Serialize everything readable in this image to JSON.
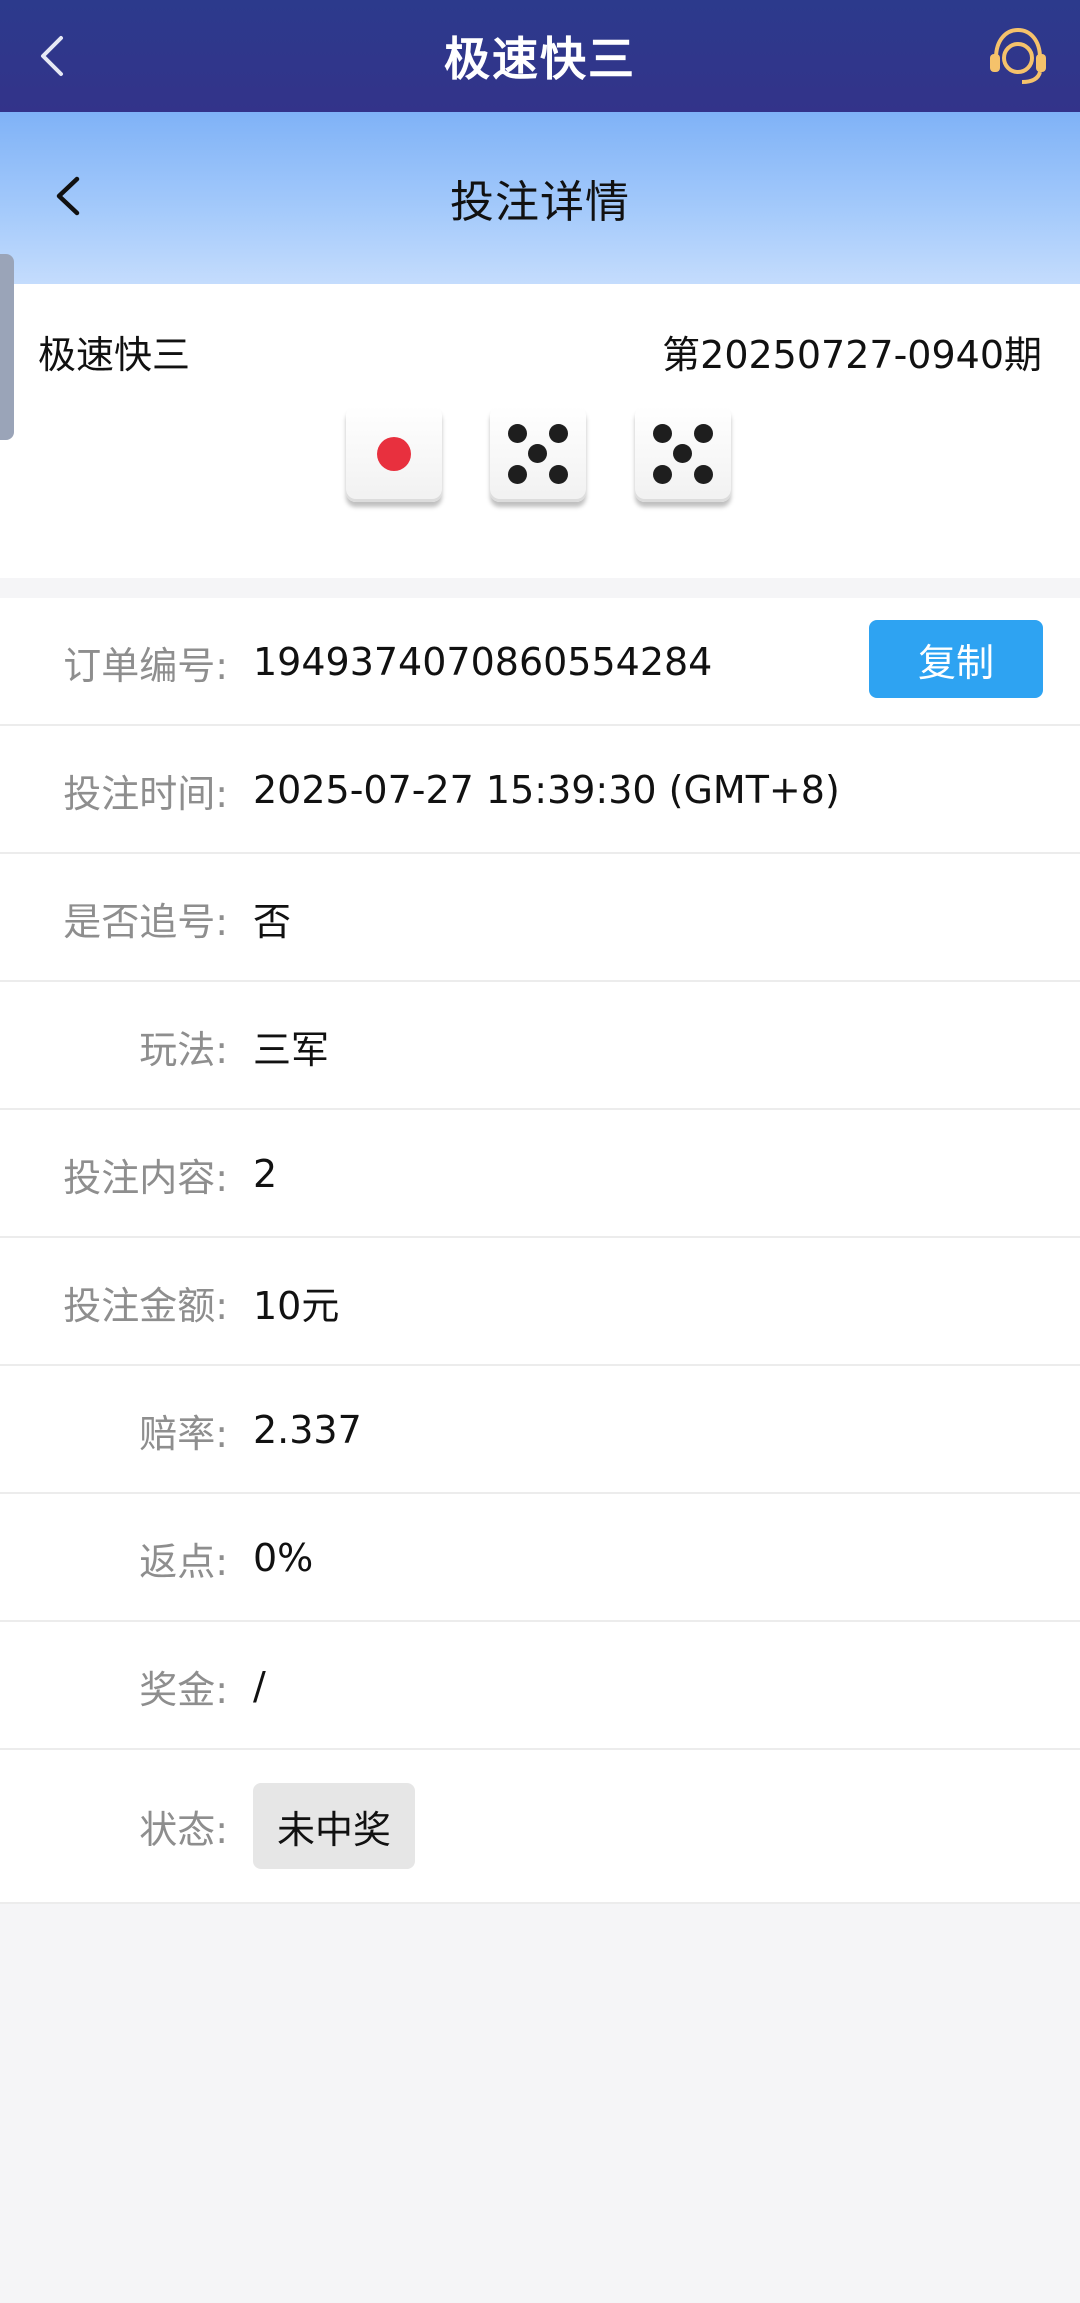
{
  "app_bar": {
    "title": "极速快三",
    "back_icon": "chevron-left-icon",
    "service_icon": "headset-icon",
    "service_color": "#f5c26b"
  },
  "sub_header": {
    "title": "投注详情",
    "back_icon": "chevron-left-icon"
  },
  "lottery": {
    "name": "极速快三",
    "issue": "第20250727-0940期",
    "dice": [
      1,
      5,
      5
    ]
  },
  "details": {
    "order_no": {
      "label": "订单编号:",
      "value": "1949374070860554284",
      "copy_label": "复制"
    },
    "bet_time": {
      "label": "投注时间:",
      "value": "2025-07-27 15:39:30 (GMT+8)"
    },
    "chase": {
      "label": "是否追号:",
      "value": "否"
    },
    "play": {
      "label": "玩法:",
      "value": "三军"
    },
    "content": {
      "label": "投注内容:",
      "value": "2"
    },
    "amount": {
      "label": "投注金额:",
      "value": "10元"
    },
    "odds": {
      "label": "赔率:",
      "value": "2.337"
    },
    "rebate": {
      "label": "返点:",
      "value": "0%"
    },
    "prize": {
      "label": "奖金:",
      "value": "/"
    },
    "status": {
      "label": "状态:",
      "value": "未中奖"
    }
  },
  "colors": {
    "primary": "#2ea3f2",
    "header_dark": "#2c3a8c",
    "dice_red": "#e8303e"
  }
}
